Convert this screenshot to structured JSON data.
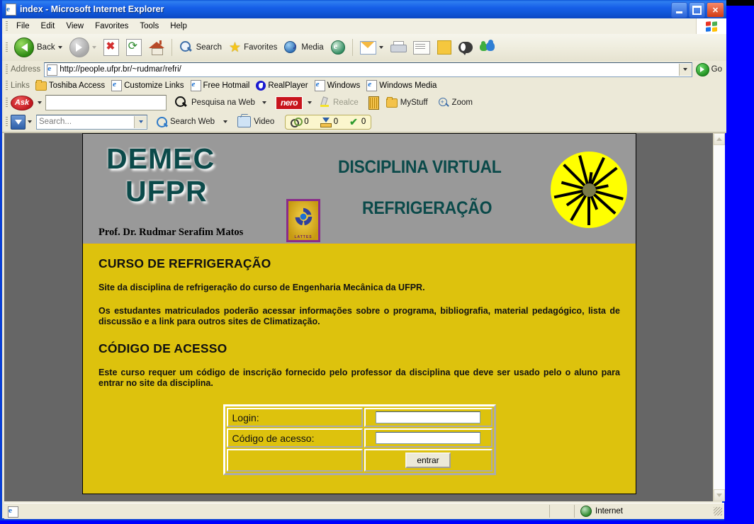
{
  "window": {
    "title": "index - Microsoft Internet Explorer",
    "icon": "ie-page-icon",
    "minimize_label": "Minimize",
    "maximize_label": "Maximize",
    "close_label": "Close"
  },
  "menu": {
    "items": [
      {
        "label": "File"
      },
      {
        "label": "Edit"
      },
      {
        "label": "View"
      },
      {
        "label": "Favorites"
      },
      {
        "label": "Tools"
      },
      {
        "label": "Help"
      }
    ]
  },
  "toolbar": {
    "back_label": "Back",
    "forward_label": "",
    "stop_label": "",
    "refresh_label": "",
    "home_label": "",
    "search_label": "Search",
    "favorites_label": "Favorites",
    "media_label": "Media",
    "history_label": "",
    "mail_label": "",
    "print_label": "",
    "edit_label": "",
    "discuss_label": "",
    "messenger_label": ""
  },
  "address": {
    "label": "Address",
    "url": "http://people.ufpr.br/~rudmar/refri/",
    "go_label": "Go"
  },
  "links": {
    "label": "Links",
    "items": [
      {
        "label": "Toshiba Access",
        "icon": "folder-icon"
      },
      {
        "label": "Customize Links",
        "icon": "page-icon"
      },
      {
        "label": "Free Hotmail",
        "icon": "page-icon"
      },
      {
        "label": "RealPlayer",
        "icon": "realplayer-icon"
      },
      {
        "label": "Windows",
        "icon": "page-icon"
      },
      {
        "label": "Windows Media",
        "icon": "page-icon"
      }
    ]
  },
  "ask_toolbar": {
    "logo": "Ask",
    "search_value": "",
    "search_web_label": "Pesquisa na Web",
    "nero_label": "nero",
    "highlight_label": "Realce",
    "shelf_label": "",
    "mystuff_label": "MyStuff",
    "zoom_label": "Zoom"
  },
  "download_toolbar": {
    "search_placeholder": "Search...",
    "search_web_label": "Search Web",
    "video_label": "Video",
    "counters": [
      {
        "name": "blocked",
        "value": "0"
      },
      {
        "name": "downloads",
        "value": "0"
      },
      {
        "name": "checked",
        "value": "0"
      }
    ]
  },
  "page": {
    "header": {
      "demec": "DEMEC",
      "ufpr": "UFPR",
      "professor": "Prof. Dr. Rudmar Serafim Matos",
      "lattes_label": "LATTES",
      "title_line1": "DISCIPLINA VIRTUAL",
      "title_line2": "REFRIGERAÇÃO"
    },
    "heading1": "CURSO DE REFRIGERAÇÃO",
    "paragraph1": "Site da disciplina de refrigeração do curso de Engenharia Mecânica da UFPR.",
    "paragraph2": "Os estudantes matriculados poderão acessar informações sobre o programa, bibliografia, material pedagógico, lista de discussão e a link para outros sites de Climatização.",
    "heading2": "CÓDIGO DE ACESSO",
    "paragraph3": "Este curso requer um código de inscrição fornecido pelo professor da disciplina que deve ser usado pelo o aluno para entrar no site da disciplina.",
    "form": {
      "login_label": "Login:",
      "login_value": "",
      "code_label": "Código de acesso:",
      "code_value": "",
      "submit_label": "entrar"
    },
    "colors": {
      "body_background": "#666666",
      "header_background": "#999999",
      "content_background": "#ddc20d",
      "heading_teal": "#0b4a4a",
      "sun_yellow": "#ffff00"
    }
  },
  "status": {
    "message": "",
    "zone": "Internet"
  }
}
